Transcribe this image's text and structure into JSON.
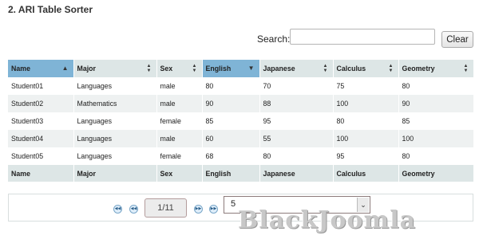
{
  "title": "2. ARI Table Sorter",
  "search": {
    "label": "Search:",
    "value": "",
    "clear_label": "Clear"
  },
  "table": {
    "columns": [
      {
        "label": "Name",
        "sort": "asc"
      },
      {
        "label": "Major",
        "sort": "both"
      },
      {
        "label": "Sex",
        "sort": "both"
      },
      {
        "label": "English",
        "sort": "desc"
      },
      {
        "label": "Japanese",
        "sort": "both"
      },
      {
        "label": "Calculus",
        "sort": "both"
      },
      {
        "label": "Geometry",
        "sort": "both"
      }
    ],
    "rows": [
      [
        "Student01",
        "Languages",
        "male",
        "80",
        "70",
        "75",
        "80"
      ],
      [
        "Student02",
        "Mathematics",
        "male",
        "90",
        "88",
        "100",
        "90"
      ],
      [
        "Student03",
        "Languages",
        "female",
        "85",
        "95",
        "80",
        "85"
      ],
      [
        "Student04",
        "Languages",
        "male",
        "60",
        "55",
        "100",
        "100"
      ],
      [
        "Student05",
        "Languages",
        "female",
        "68",
        "80",
        "95",
        "80"
      ]
    ],
    "footer": [
      "Name",
      "Major",
      "Sex",
      "English",
      "Japanese",
      "Calculus",
      "Geometry"
    ]
  },
  "pager": {
    "first_icon": "first-page-icon",
    "prev_icon": "prev-page-icon",
    "next_icon": "next-page-icon",
    "last_icon": "last-page-icon",
    "page_display": "1/11",
    "page_size": "5"
  },
  "watermark": "BlackJoomla",
  "colors": {
    "header_bg": "#dde6e6",
    "sorted_header_bg": "#7fb4d6",
    "alt_row_bg": "#eef1f1"
  }
}
